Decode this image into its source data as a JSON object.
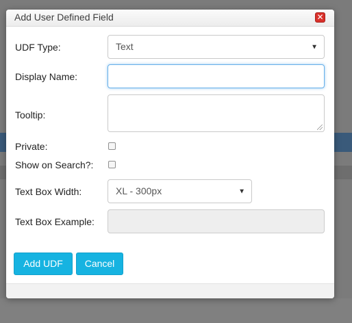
{
  "dialog": {
    "title": "Add User Defined Field",
    "close_icon": "close-icon",
    "close_symbol": "✕"
  },
  "form": {
    "udf_type": {
      "label": "UDF Type:",
      "value": "Text"
    },
    "display_name": {
      "label": "Display Name:",
      "value": ""
    },
    "tooltip": {
      "label": "Tooltip:",
      "value": ""
    },
    "private": {
      "label": "Private:",
      "checked": false
    },
    "show_on_search": {
      "label": "Show on Search?:",
      "checked": false
    },
    "text_box_width": {
      "label": "Text Box Width:",
      "value": "XL - 300px"
    },
    "text_box_example": {
      "label": "Text Box Example:",
      "value": ""
    }
  },
  "buttons": {
    "add_label": "Add UDF",
    "cancel_label": "Cancel"
  },
  "icons": {
    "dropdown": "▼"
  },
  "colors": {
    "primary_button": "#16b3e1",
    "close_button": "#d9312b",
    "focus_border": "#66afe9",
    "overlay": "#7b7b7b"
  }
}
